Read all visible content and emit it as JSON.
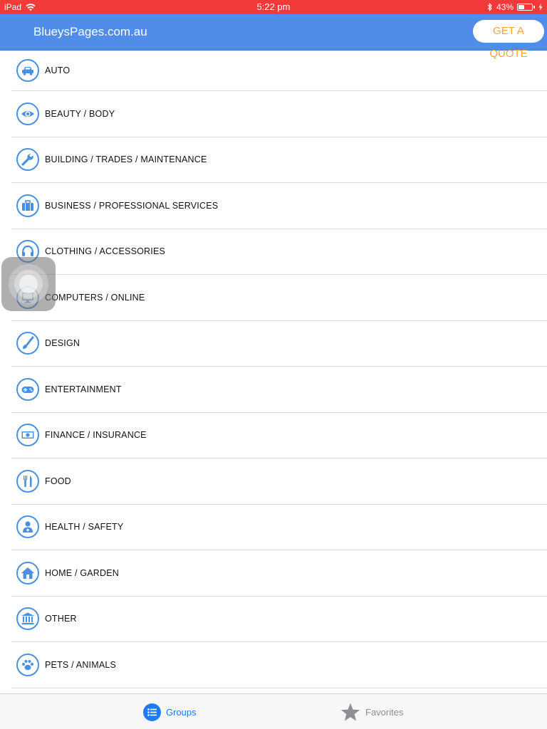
{
  "status_bar": {
    "device": "iPad",
    "time": "5:22 pm",
    "battery_percent_label": "43%",
    "battery_level": 0.43,
    "background_color": "#f23a3a"
  },
  "nav_bar": {
    "title": "BlueysPages.com.au",
    "quote_button_label": "GET A QUOTE",
    "background_color": "#4f8de9",
    "quote_text_color": "#f0a43a"
  },
  "categories": [
    {
      "label": "AUTO",
      "icon": "car-icon"
    },
    {
      "label": "BEAUTY / BODY",
      "icon": "eye-icon"
    },
    {
      "label": "BUILDING / TRADES / MAINTENANCE",
      "icon": "wrench-icon"
    },
    {
      "label": "BUSINESS / PROFESSIONAL SERVICES",
      "icon": "briefcase-icon"
    },
    {
      "label": "CLOTHING / ACCESSORIES",
      "icon": "headphones-icon"
    },
    {
      "label": "COMPUTERS / ONLINE",
      "icon": "monitor-icon"
    },
    {
      "label": "DESIGN",
      "icon": "paintbrush-icon"
    },
    {
      "label": "ENTERTAINMENT",
      "icon": "gamepad-icon"
    },
    {
      "label": "FINANCE / INSURANCE",
      "icon": "money-icon"
    },
    {
      "label": "FOOD",
      "icon": "cutlery-icon"
    },
    {
      "label": "HEALTH / SAFETY",
      "icon": "doctor-icon"
    },
    {
      "label": "HOME / GARDEN",
      "icon": "home-icon"
    },
    {
      "label": "OTHER",
      "icon": "bank-icon"
    },
    {
      "label": "PETS / ANIMALS",
      "icon": "paw-icon"
    }
  ],
  "accent_color": "#4a90e2",
  "tab_bar": {
    "tabs": [
      {
        "label": "Groups",
        "icon": "list-icon",
        "selected": true,
        "color": "#1e7cf2"
      },
      {
        "label": "Favorites",
        "icon": "star-icon",
        "selected": false,
        "color": "#8e8e93"
      }
    ]
  }
}
